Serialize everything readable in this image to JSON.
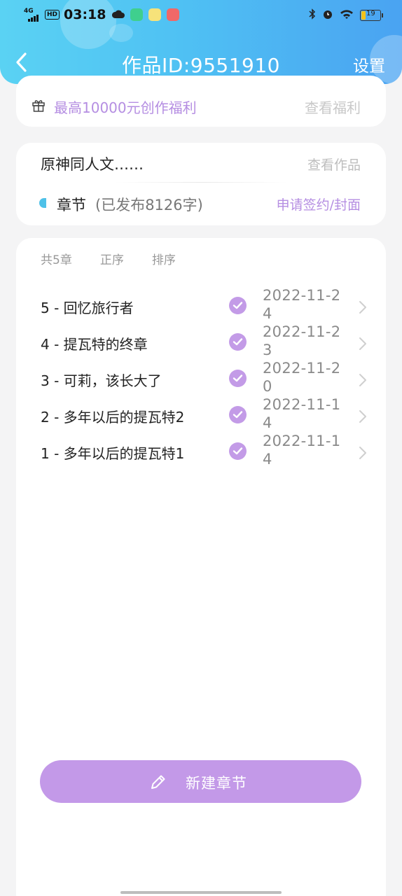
{
  "status_bar": {
    "network": "4G",
    "hd": "HD",
    "time": "03:18",
    "battery": "19"
  },
  "nav": {
    "title": "作品ID:9551910",
    "settings_label": "设置"
  },
  "benefit": {
    "text": "最高10000元创作福利",
    "link": "查看福利"
  },
  "work": {
    "title": "原神同人文……",
    "view_link": "查看作品",
    "chapter_label": "章节",
    "published": "(已发布8126字)",
    "sign_link": "申请签约/封面"
  },
  "list": {
    "total": "共5章",
    "order": "正序",
    "sort": "排序",
    "chapters": [
      {
        "title": "5 - 回忆旅行者",
        "date": "2022-11-24"
      },
      {
        "title": "4 - 提瓦特的终章",
        "date": "2022-11-23"
      },
      {
        "title": "3 - 可莉，该长大了",
        "date": "2022-11-20"
      },
      {
        "title": "2 - 多年以后的提瓦特2",
        "date": "2022-11-14"
      },
      {
        "title": "1 - 多年以后的提瓦特1",
        "date": "2022-11-14"
      }
    ]
  },
  "new_chapter_label": "新建章节",
  "colors": {
    "accent_purple": "#c399e8",
    "header_blue": "#4fc1f3",
    "chapter_marker": "#4fc1e8"
  },
  "icons": {
    "back": "chevron-left-icon",
    "gift": "gift-icon",
    "check": "check-circle-icon",
    "arrow": "chevron-right-icon",
    "pen": "pencil-icon"
  }
}
